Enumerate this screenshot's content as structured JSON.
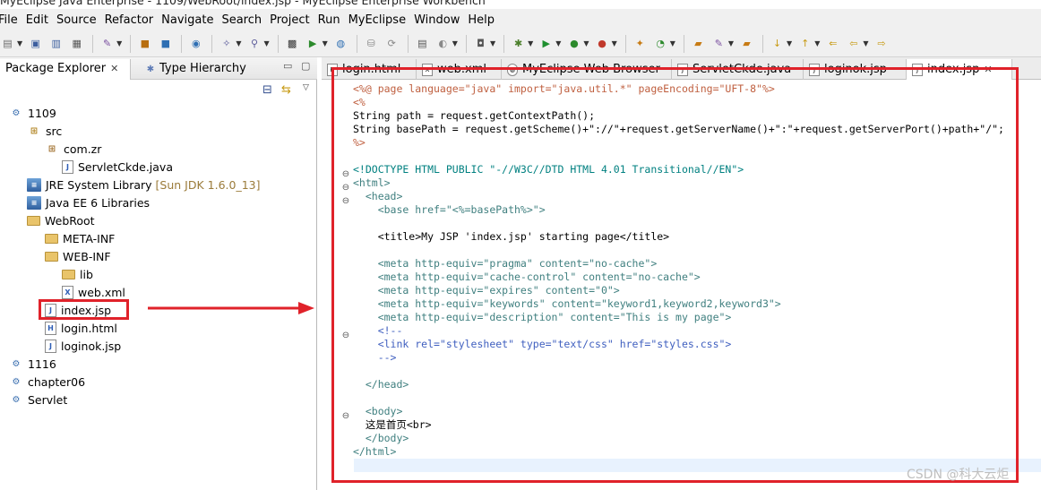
{
  "window": {
    "title": "MyEclipse Java Enterprise - 1109/WebRoot/index.jsp - MyEclipse Enterprise Workbench"
  },
  "menu": [
    "File",
    "Edit",
    "Source",
    "Refactor",
    "Navigate",
    "Search",
    "Project",
    "Run",
    "MyEclipse",
    "Window",
    "Help"
  ],
  "explorer": {
    "tab_active": "Package Explorer",
    "tab_inactive": "Type Hierarchy",
    "close_glyph": "✕",
    "tree": [
      {
        "label": "1109",
        "icon": "project-icon",
        "depth": 0
      },
      {
        "label": "src",
        "icon": "source-folder-icon",
        "depth": 1
      },
      {
        "label": "com.zr",
        "icon": "package-icon",
        "depth": 2
      },
      {
        "label": "ServletCkde.java",
        "icon": "java-file-icon",
        "depth": 3
      },
      {
        "label": "JRE System Library",
        "extra": "[Sun JDK 1.6.0_13]",
        "icon": "library-icon",
        "depth": 1
      },
      {
        "label": "Java EE 6 Libraries",
        "icon": "library-icon",
        "depth": 1
      },
      {
        "label": "WebRoot",
        "icon": "folder-icon",
        "depth": 1
      },
      {
        "label": "META-INF",
        "icon": "folder-icon",
        "depth": 2
      },
      {
        "label": "WEB-INF",
        "icon": "folder-icon",
        "depth": 2
      },
      {
        "label": "lib",
        "icon": "folder-icon",
        "depth": 3
      },
      {
        "label": "web.xml",
        "icon": "xml-file-icon",
        "depth": 3
      },
      {
        "label": "index.jsp",
        "icon": "jsp-file-icon",
        "depth": 2
      },
      {
        "label": "login.html",
        "icon": "html-file-icon",
        "depth": 2
      },
      {
        "label": "loginok.jsp",
        "icon": "jsp-file-icon",
        "depth": 2
      },
      {
        "label": "1116",
        "icon": "project-icon",
        "depth": 0
      },
      {
        "label": "chapter06",
        "icon": "project-icon",
        "depth": 0
      },
      {
        "label": "Servlet",
        "icon": "project-icon",
        "depth": 0
      }
    ]
  },
  "editor": {
    "tabs": [
      {
        "label": "login.html",
        "icon": "html-file-icon"
      },
      {
        "label": "web.xml",
        "icon": "xml-file-icon"
      },
      {
        "label": "MyEclipse Web Browser",
        "icon": "browser-icon"
      },
      {
        "label": "ServletCkde.java",
        "icon": "java-file-icon"
      },
      {
        "label": "loginok.jsp",
        "icon": "jsp-file-icon"
      },
      {
        "label": "index.jsp",
        "icon": "jsp-file-icon",
        "active": true
      }
    ],
    "code": [
      "<%@ page language=\"java\" import=\"java.util.*\" pageEncoding=\"UFT-8\"%>",
      "<%",
      "String path = request.getContextPath();",
      "String basePath = request.getScheme()+\"://\"+request.getServerName()+\":\"+request.getServerPort()+path+\"/\";",
      "%>",
      "",
      "<!DOCTYPE HTML PUBLIC \"-//W3C//DTD HTML 4.01 Transitional//EN\">",
      "<html>",
      "  <head>",
      "    <base href=\"<%=basePath%>\">",
      "",
      "    <title>My JSP 'index.jsp' starting page</title>",
      "",
      "    <meta http-equiv=\"pragma\" content=\"no-cache\">",
      "    <meta http-equiv=\"cache-control\" content=\"no-cache\">",
      "    <meta http-equiv=\"expires\" content=\"0\">",
      "    <meta http-equiv=\"keywords\" content=\"keyword1,keyword2,keyword3\">",
      "    <meta http-equiv=\"description\" content=\"This is my page\">",
      "    <!--",
      "    <link rel=\"stylesheet\" type=\"text/css\" href=\"styles.css\">",
      "    -->",
      "",
      "  </head>",
      "",
      "  <body>",
      "  这是首页<br>",
      "  </body>",
      "</html>"
    ]
  },
  "watermark": "CSDN @科大云炬",
  "colors": {
    "highlight_box": "#e0222a"
  }
}
